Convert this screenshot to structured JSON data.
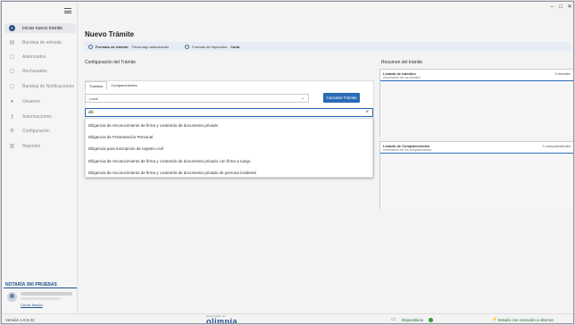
{
  "window": {
    "minimize": "–",
    "maximize": "□",
    "close": "✕"
  },
  "sidebar": {
    "items": [
      {
        "label": "Iniciar nuevo trámite",
        "icon": "plus-circle-icon",
        "glyph": "+",
        "active": true
      },
      {
        "label": "Bandeja de entrada",
        "icon": "inbox-icon",
        "glyph": "▤"
      },
      {
        "label": "Autorizados",
        "icon": "document-check-icon",
        "glyph": "▢"
      },
      {
        "label": "Rechazados",
        "icon": "document-x-icon",
        "glyph": "▢"
      },
      {
        "label": "Bandeja de Notificaciones",
        "icon": "bell-document-icon",
        "glyph": "▢"
      },
      {
        "label": "Usuarios",
        "icon": "user-icon",
        "glyph": "●"
      },
      {
        "label": "Autorizaciones",
        "icon": "key-icon",
        "glyph": "⚷"
      },
      {
        "label": "Configuración",
        "icon": "gear-icon",
        "glyph": "⚙"
      },
      {
        "label": "Reportes",
        "icon": "bar-chart-icon",
        "glyph": "▥"
      }
    ],
    "notaria": "NOTARÍA 360 PRUEBAS",
    "logout": "Cerrar Sesión"
  },
  "main": {
    "title": "Nuevo Trámite",
    "infobar": {
      "format_label": "Formato de trámite:",
      "format_value": "Firma bajo autorización",
      "print_label": "Formato de impresión:",
      "print_value": "Carta"
    },
    "config_title": "Configuración del Trámite",
    "tabs": [
      "Trámites",
      "Comparecientes"
    ],
    "select_value": "Local",
    "cancel_button": "Cancelar Trámite",
    "search_value": "dili",
    "dropdown_items": [
      "Diligencia de reconocimiento de firma y contenido de documento privado",
      "Diligencia de Presentación Personal",
      "Diligencia para Inscripción de registro civil",
      "Diligencia de reconocimiento de firma y contenido de documento privado con firma a ruego",
      "Diligencia de reconocimiento de firma y contenido de documento privado de persona invidente"
    ]
  },
  "summary": {
    "title": "Resumen del trámite",
    "procedures": {
      "title": "Listado de trámites",
      "subtitle": "Información de los trámites",
      "count": "0 trámites"
    },
    "appearers": {
      "title": "Listado de Comparecientes",
      "subtitle": "Información de los comparecientes",
      "count": "0 comparecientes"
    }
  },
  "statusbar": {
    "version": "Versión 1.0.0.22",
    "brand_top": "Desarrollado por",
    "brand": "olimpia",
    "devices": "Dispositivos",
    "connection": "Estado con conexión a internet",
    "ok_color": "#2e9b3c"
  }
}
